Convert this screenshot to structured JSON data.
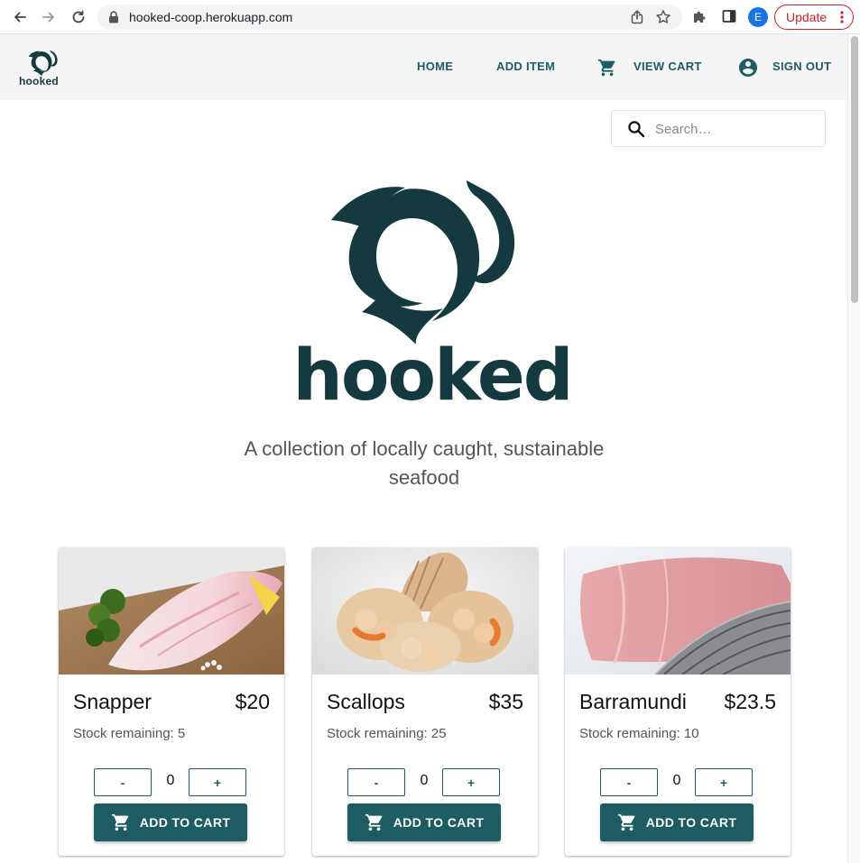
{
  "browser": {
    "url": "hooked-coop.herokuapp.com",
    "profile_initial": "E",
    "update_label": "Update"
  },
  "header": {
    "brand_text": "hooked",
    "nav": {
      "home": "HOME",
      "add_item": "ADD ITEM",
      "view_cart": "VIEW CART",
      "sign_out": "SIGN OUT"
    }
  },
  "search": {
    "placeholder": "Search…",
    "value": ""
  },
  "hero": {
    "wordmark": "hooked",
    "tagline": "A collection of locally caught, sustainable seafood"
  },
  "products": [
    {
      "name": "Snapper",
      "price": "$20",
      "stock": "Stock remaining: 5",
      "quantity": "0",
      "minus": "-",
      "plus": "+",
      "add_label": "ADD TO CART"
    },
    {
      "name": "Scallops",
      "price": "$35",
      "stock": "Stock remaining: 25",
      "quantity": "0",
      "minus": "-",
      "plus": "+",
      "add_label": "ADD TO CART"
    },
    {
      "name": "Barramundi",
      "price": "$23.5",
      "stock": "Stock remaining: 10",
      "quantity": "0",
      "minus": "-",
      "plus": "+",
      "add_label": "ADD TO CART"
    }
  ],
  "colors": {
    "brand_dark": "#143a40",
    "primary": "#1d5c63",
    "header_bg": "#f5f5f5"
  }
}
